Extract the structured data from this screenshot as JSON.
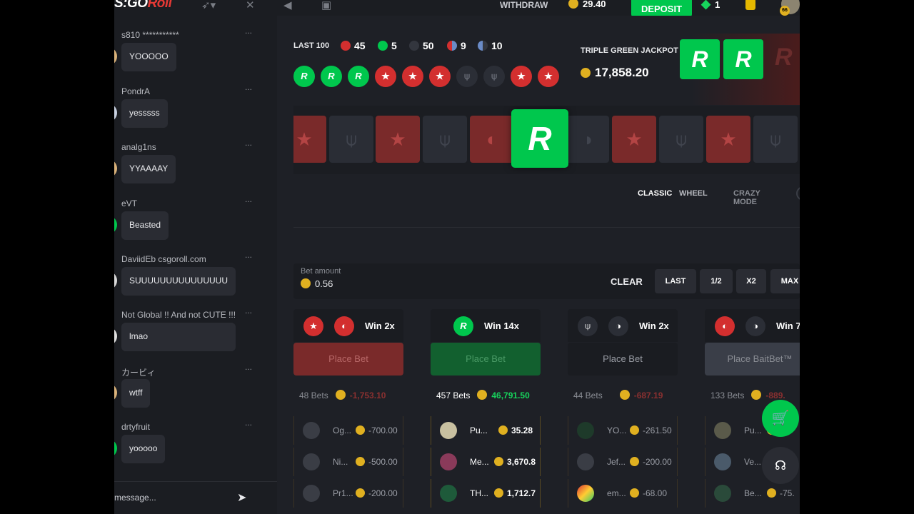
{
  "header": {
    "logo_a": "S:GO",
    "logo_b": "Roll",
    "withdraw": "WITHDRAW",
    "balance": "29.40",
    "deposit": "DEPOSIT",
    "gems": "1",
    "avatar_level": "66"
  },
  "chat": {
    "placeholder": "message...",
    "messages": [
      {
        "user": "s810 ***********",
        "text": "YOOOOO"
      },
      {
        "user": "PondrA",
        "text": "yesssss"
      },
      {
        "user": "analg1ns",
        "text": "YYAAAAY"
      },
      {
        "user": "eVT",
        "text": "Beasted"
      },
      {
        "user": "DaviidEb csgoroll.com",
        "text": "SUUUUUUUUUUUUUUU"
      },
      {
        "user": "Not Global !! And not CUTE !!!",
        "text": "lmao"
      },
      {
        "user": "カービィ",
        "text": "wtff"
      },
      {
        "user": "drtyfruit",
        "text": "yooooo"
      }
    ]
  },
  "history": {
    "label": "LAST 100",
    "counts": {
      "red": "45",
      "green": "5",
      "black": "50",
      "red_bait": "9",
      "black_bait": "10"
    },
    "recent": [
      "green",
      "green",
      "green",
      "red",
      "red",
      "red",
      "black",
      "black",
      "red",
      "red"
    ]
  },
  "jackpot": {
    "title": "TRIPLE GREEN JACKPOT",
    "amount": "17,858.20"
  },
  "modes": {
    "classic": "CLASSIC",
    "wheel": "WHEEL",
    "crazy": "CRAZY MODE"
  },
  "bet": {
    "label": "Bet amount",
    "value": "0.56",
    "clear": "CLEAR",
    "last": "LAST",
    "half": "1/2",
    "double": "X2",
    "max": "MAX"
  },
  "columns": [
    {
      "win": "Win 2x",
      "place": "Place Bet",
      "bets": "48 Bets",
      "total": "-1,753.10",
      "rows": [
        {
          "name": "Og...",
          "amount": "-700.00"
        },
        {
          "name": "Ni...",
          "amount": "-500.00"
        },
        {
          "name": "Pr1...",
          "amount": "-200.00"
        }
      ]
    },
    {
      "win": "Win 14x",
      "place": "Place Bet",
      "bets": "457 Bets",
      "total": "46,791.50",
      "rows": [
        {
          "name": "Pu...",
          "amount": "35.28"
        },
        {
          "name": "Me...",
          "amount": "3,670.8"
        },
        {
          "name": "TH...",
          "amount": "1,712.7"
        }
      ]
    },
    {
      "win": "Win 2x",
      "place": "Place Bet",
      "bets": "44 Bets",
      "total": "-687.19",
      "rows": [
        {
          "name": "YO...",
          "amount": "-261.50"
        },
        {
          "name": "Jef...",
          "amount": "-200.00"
        },
        {
          "name": "em...",
          "amount": "-68.00"
        }
      ]
    },
    {
      "win": "Win 7",
      "place": "Place BaitBet™",
      "bets": "133 Bets",
      "total": "-889.",
      "rows": [
        {
          "name": "Pu...",
          "amount": ""
        },
        {
          "name": "Ve...",
          "amount": ""
        },
        {
          "name": "Be...",
          "amount": "-75."
        }
      ]
    }
  ],
  "colors": {
    "green": "#00c74d",
    "red": "#d32f2f",
    "gold": "#e0b020",
    "bg": "#1e2026"
  }
}
